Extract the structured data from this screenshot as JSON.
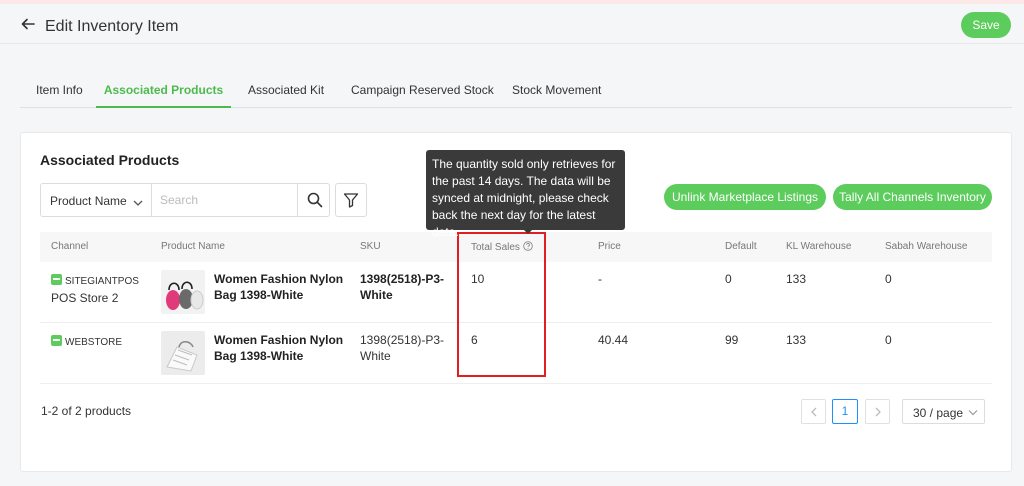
{
  "header": {
    "title": "Edit Inventory Item",
    "save_label": "Save"
  },
  "tabs": [
    {
      "label": "Item Info",
      "active": false
    },
    {
      "label": "Associated Products",
      "active": true
    },
    {
      "label": "Associated Kit",
      "active": false
    },
    {
      "label": "Campaign Reserved Stock",
      "active": false
    },
    {
      "label": "Stock Movement",
      "active": false
    }
  ],
  "section": {
    "title": "Associated Products"
  },
  "search": {
    "field_selected": "Product Name",
    "placeholder": "Search"
  },
  "tooltip": {
    "text": "The quantity sold only retrieves for the past 14 days. The data will be synced at midnight, please check back the next day for the latest data."
  },
  "actions": {
    "unlink_label": "Unlink Marketplace Listings",
    "tally_label": "Tally All Channels Inventory"
  },
  "table": {
    "columns": [
      "Channel",
      "Product Name",
      "SKU",
      "Total Sales",
      "Price",
      "Default",
      "KL Warehouse",
      "Sabah Warehouse"
    ],
    "rows": [
      {
        "channel": "SITEGIANTPOS",
        "store": "POS Store 2",
        "product_name": "Women Fashion Nylon Bag 1398-White",
        "sku": "1398(2518)-P3-White",
        "total_sales": "10",
        "price": "-",
        "default": "0",
        "kl_warehouse": "133",
        "sabah_warehouse": "0"
      },
      {
        "channel": "WEBSTORE",
        "store": "",
        "product_name": "Women Fashion Nylon Bag 1398-White",
        "sku": "1398(2518)-P3-White",
        "total_sales": "6",
        "price": "40.44",
        "default": "99",
        "kl_warehouse": "133",
        "sabah_warehouse": "0"
      }
    ]
  },
  "pagination": {
    "summary": "1-2 of 2 products",
    "current_page": "1",
    "page_size": "30 / page"
  },
  "colors": {
    "accent": "#5ccc5c",
    "active_tab": "#4cbb4c",
    "highlight": "#e02020",
    "tooltip_bg": "#3a3a3a",
    "page_link": "#1e90ff"
  }
}
